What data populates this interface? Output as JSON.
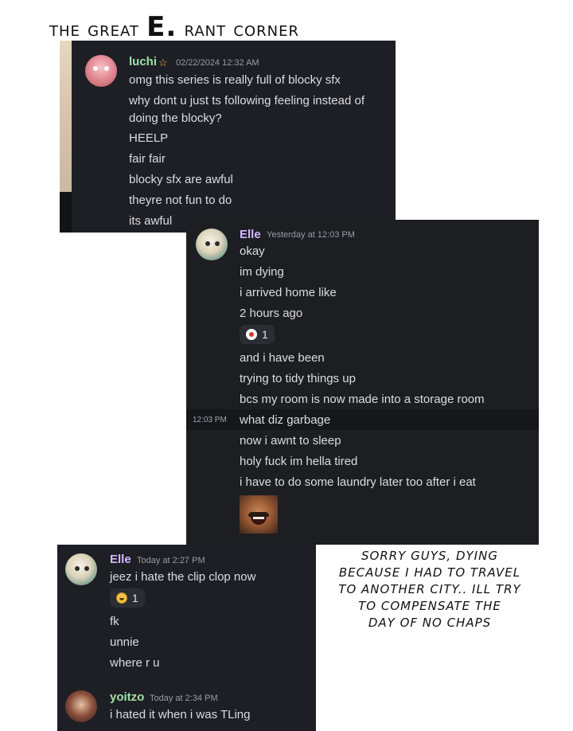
{
  "page_title": {
    "prefix": "the great ",
    "big": "E.",
    "suffix": " rant corner"
  },
  "panel1": {
    "username": "luchi",
    "star": "☆",
    "timestamp": "02/22/2024 12:32 AM",
    "username_color": "#9fe0a8",
    "messages": [
      "omg this series is really full of blocky sfx",
      "why dont u just ts following feeling instead of",
      "doing the blocky?",
      "HEELP",
      "fair fair",
      "blocky sfx are awful",
      "theyre not fun to do",
      "its awful"
    ]
  },
  "panel2": {
    "username": "Elle",
    "timestamp": "Yesterday at 12:03 PM",
    "username_color": "#d2b9ff",
    "messages": [
      "okay",
      "im dying",
      "i arrived home like",
      "2 hours ago"
    ],
    "reaction": {
      "icon": "red-dot-emoji",
      "count": "1"
    },
    "messages_after": [
      "and i have been",
      "trying to tidy things up",
      "bcs my room is now made into a storage room"
    ],
    "hover_time": "12:03 PM",
    "highlighted_message": "what diz garbage",
    "messages_end": [
      "now i awnt to sleep",
      "holy fuck im hella tired",
      "i have to do some laundry later too after i eat"
    ],
    "emoji_name": "laughing-man-emoji"
  },
  "panel3": {
    "user1": {
      "username": "Elle",
      "timestamp": "Today at 2:27 PM",
      "username_color": "#d2b9ff",
      "messages_before": [
        "jeez i hate the clip clop now"
      ],
      "reaction": {
        "icon": "laughing-emoji",
        "count": "1"
      },
      "messages_after": [
        "fk",
        "unnie",
        "where r u"
      ]
    },
    "user2": {
      "username": "yoitzo",
      "timestamp": "Today at 2:34 PM",
      "username_color": "#9fe0a8",
      "messages": [
        "i hated it when i was TLing"
      ]
    }
  },
  "note": {
    "lines": [
      "Sorry guys, dying",
      "because I had to travel",
      "to another city.. Ill try",
      "to compensate the",
      "day of no chaps"
    ]
  }
}
